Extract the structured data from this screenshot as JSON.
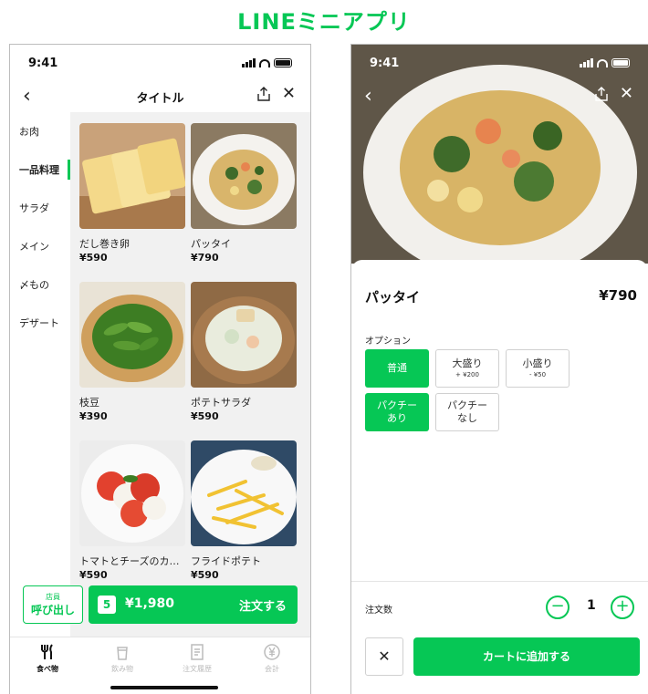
{
  "header": {
    "title": "LINEミニアプリ"
  },
  "left_screen": {
    "status": {
      "time": "9:41"
    },
    "nav": {
      "title": "タイトル"
    },
    "categories": [
      {
        "label": "お肉"
      },
      {
        "label": "一品料理"
      },
      {
        "label": "サラダ"
      },
      {
        "label": "メイン"
      },
      {
        "label": "〆もの"
      },
      {
        "label": "デザート"
      }
    ],
    "products": [
      {
        "name": "だし巻き卵",
        "price": "¥590"
      },
      {
        "name": "パッタイ",
        "price": "¥790"
      },
      {
        "name": "枝豆",
        "price": "¥390"
      },
      {
        "name": "ポテトサラダ",
        "price": "¥590"
      },
      {
        "name": "トマトとチーズのカ…",
        "price": "¥590"
      },
      {
        "name": "フライドポテト",
        "price": "¥590"
      }
    ],
    "call_staff": {
      "line1": "店員",
      "line2": "呼び出し"
    },
    "order_bar": {
      "count": "5",
      "total": "¥1,980",
      "label": "注文する"
    },
    "tabs": [
      {
        "label": "食べ物",
        "icon": "fork-knife-icon"
      },
      {
        "label": "飲み物",
        "icon": "cup-icon"
      },
      {
        "label": "注文履歴",
        "icon": "receipt-icon"
      },
      {
        "label": "会計",
        "icon": "yen-coin-icon"
      }
    ]
  },
  "right_screen": {
    "status": {
      "time": "9:41"
    },
    "product": {
      "name": "パッタイ",
      "price": "¥790"
    },
    "option_title": "オプション",
    "options": [
      {
        "label": "普通",
        "sub": "",
        "selected": true
      },
      {
        "label": "大盛り",
        "sub": "+ ¥200",
        "selected": false
      },
      {
        "label": "小盛り",
        "sub": "- ¥50",
        "selected": false
      },
      {
        "label": "パクチー",
        "sub": "あり",
        "selected": true
      },
      {
        "label": "パクチー",
        "sub": "なし",
        "selected": false
      }
    ],
    "quantity": {
      "label": "注文数",
      "value": "1",
      "minus": "−",
      "plus": "+"
    },
    "close_label": "✕",
    "add_to_cart": "カートに追加する"
  },
  "colors": {
    "accent": "#06c755"
  }
}
